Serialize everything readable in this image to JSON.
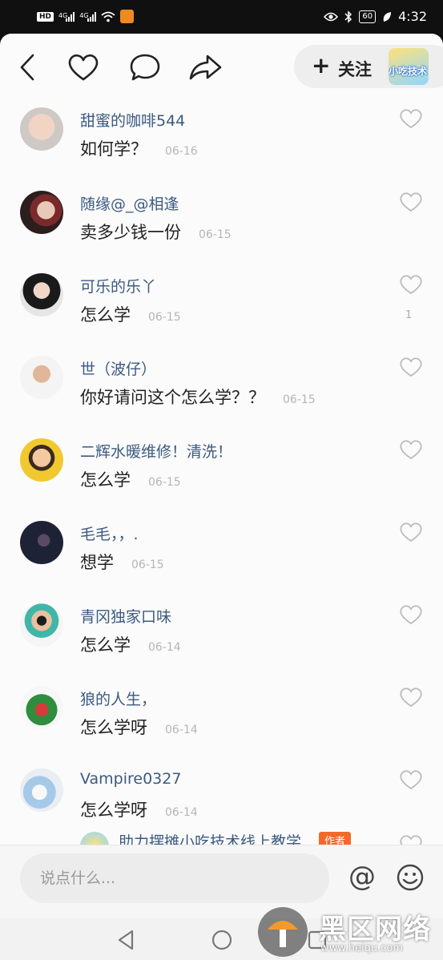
{
  "status_bar": {
    "hd_label": "HD",
    "net_1": "4G",
    "net_2": "4G",
    "battery": "60",
    "time": "4:32"
  },
  "topbar": {
    "follow_label": "关注",
    "follow_avatar_text": "小吃技术"
  },
  "comments": [
    {
      "name": "甜蜜的咖啡544",
      "text": "如何学？",
      "date": "06-16",
      "likes": ""
    },
    {
      "name": "随缘@_@相逢",
      "text": "卖多少钱一份",
      "date": "06-15",
      "likes": ""
    },
    {
      "name": "可乐的乐丫",
      "text": "怎么学",
      "date": "06-15",
      "likes": "1"
    },
    {
      "name": "世（波仔）",
      "text": "你好请问这个怎么学？？",
      "date": "06-15",
      "likes": ""
    },
    {
      "name": "二辉水暖维修！清洗！",
      "text": "怎么学",
      "date": "06-15",
      "likes": ""
    },
    {
      "name": "毛毛，，.",
      "text": "想学",
      "date": "06-15",
      "likes": ""
    },
    {
      "name": "青冈独家口味",
      "text": "怎么学",
      "date": "06-14",
      "likes": ""
    },
    {
      "name": "狼的人生，",
      "text": "怎么学呀",
      "date": "06-14",
      "likes": ""
    },
    {
      "name": "Vampire0327",
      "text": "怎么学呀",
      "date": "06-14",
      "likes": ""
    }
  ],
  "partial_comment": {
    "name": "助力摆摊小吃技术线上教学",
    "author_tag": "作者"
  },
  "input": {
    "placeholder": "说点什么..."
  },
  "watermark": {
    "title": "黑区网络",
    "url": "www.heiqu.com"
  },
  "colors": {
    "name_blue": "#3b5a80",
    "author_orange": "#f26a2a"
  }
}
